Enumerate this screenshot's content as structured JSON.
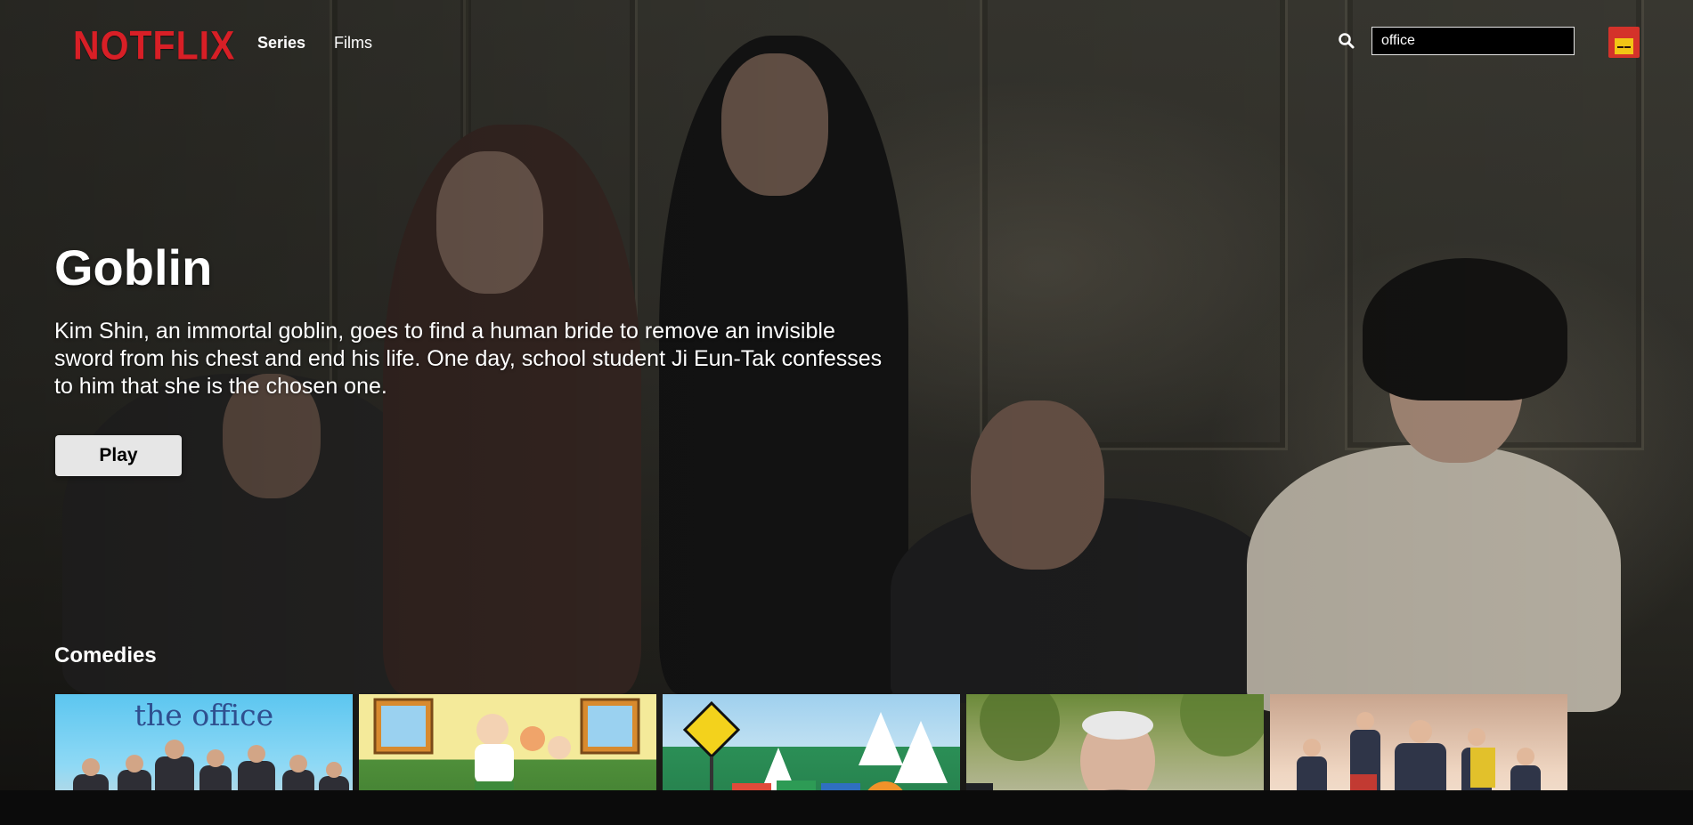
{
  "app": {
    "logo": "NOTFLIX"
  },
  "nav": {
    "links": [
      {
        "label": "Series",
        "active": true
      },
      {
        "label": "Films",
        "active": false
      }
    ],
    "search": {
      "icon": "search-icon",
      "value": "office"
    },
    "avatar": {
      "icon": "profile-avatar"
    }
  },
  "hero": {
    "title": "Goblin",
    "description": "Kim Shin, an immortal goblin, goes to find a human bride to remove an invisible sword from his chest and end his life. One day, school student Ji Eun-Tak confesses to him that she is the chosen one.",
    "play_label": "Play"
  },
  "rows": [
    {
      "title": "Comedies",
      "items": [
        {
          "name": "the-office",
          "caption": "the office"
        },
        {
          "name": "family-guy",
          "caption": ""
        },
        {
          "name": "south-park",
          "caption": ""
        },
        {
          "name": "curb-your-enthusiasm",
          "caption": ""
        },
        {
          "name": "arrested-development",
          "caption": ""
        }
      ]
    }
  ],
  "colors": {
    "brand": "#d81f26",
    "background": "#141414",
    "button": "#e6e6e6"
  }
}
